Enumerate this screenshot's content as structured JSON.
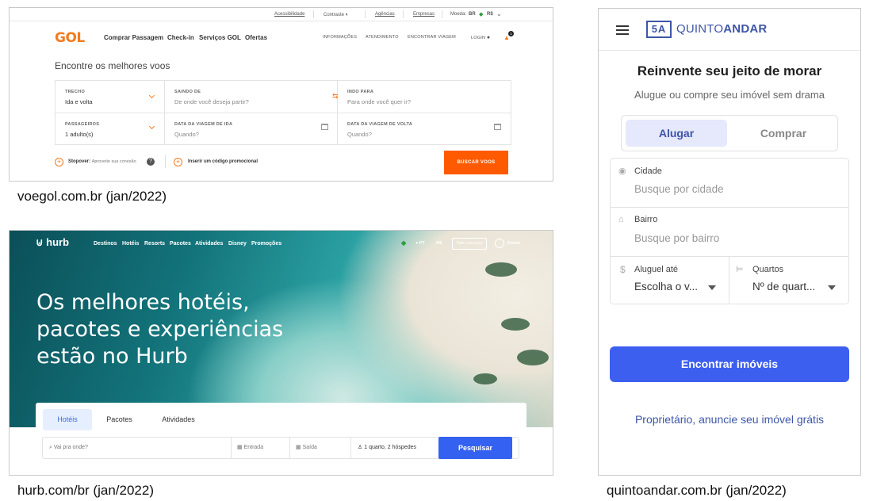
{
  "gol": {
    "topbar": {
      "acessibilidade": "Acessibilidade",
      "contraste": "Contraste",
      "agencias": "Agências",
      "empresas": "Empresas",
      "moeda": "Moeda:",
      "moeda_value": "BR",
      "currency": "R$"
    },
    "logo": "GOL",
    "nav": [
      "Comprar Passagem",
      "Check-in",
      "Serviços GOL",
      "Ofertas"
    ],
    "nav_right": [
      "INFORMAÇÕES",
      "ATENDIMENTO",
      "ENCONTRAR VIAGEM"
    ],
    "login": "LOGIN",
    "notification_count": "1",
    "heading": "Encontre os melhores voos",
    "form": {
      "trecho_label": "TRECHO",
      "trecho_value": "Ida e volta",
      "saindo_label": "SAINDO DE",
      "saindo_placeholder": "De onde você deseja partir?",
      "indo_label": "INDO PARA",
      "indo_placeholder": "Para onde você quer ir?",
      "passageiros_label": "PASSAGEIROS",
      "passageiros_value": "1 adulto(s)",
      "ida_label": "DATA DA VIAGEM DE IDA",
      "ida_placeholder": "Quando?",
      "volta_label": "DATA DA VIAGEM DE VOLTA",
      "volta_placeholder": "Quando?"
    },
    "stopover_label": "Stopover:",
    "stopover_desc": "Aproveite sua conexão",
    "promo_label": "Inserir um código promocional",
    "search_button": "BUSCAR VOOS",
    "accent_color": "#ff5a00"
  },
  "hurb": {
    "logo": "hurb",
    "nav": [
      "Destinos",
      "Hotéis",
      "Resorts",
      "Pacotes",
      "Atividades",
      "Disney",
      "Promoções"
    ],
    "lang": "PT",
    "currency": "R$",
    "contact": "Fale conosco",
    "login": "Entrar",
    "hero": [
      "Os melhores hotéis,",
      "pacotes e experiências",
      "estão no Hurb"
    ],
    "tabs": [
      "Hotéis",
      "Pacotes",
      "Atividades"
    ],
    "search": {
      "destination_placeholder": "Vai pra onde?",
      "checkin_placeholder": "Entrada",
      "checkout_placeholder": "Saída",
      "guests": "1 quarto, 2 hóspedes",
      "button": "Pesquisar"
    },
    "accent_color": "#3461f0"
  },
  "quintoandar": {
    "logo_mark": "5A",
    "logo_text_light": "QUINTO",
    "logo_text_bold": "ANDAR",
    "title": "Reinvente seu jeito de morar",
    "subtitle": "Alugue ou compre seu imóvel sem drama",
    "toggle": [
      "Alugar",
      "Comprar"
    ],
    "cidade_label": "Cidade",
    "cidade_placeholder": "Busque por cidade",
    "bairro_label": "Bairro",
    "bairro_placeholder": "Busque por bairro",
    "aluguel_label": "Aluguel até",
    "aluguel_value": "Escolha o v...",
    "quartos_label": "Quartos",
    "quartos_value": "Nº de quart...",
    "button": "Encontrar imóveis",
    "owner_link": "Proprietário, anuncie seu imóvel grátis",
    "accent_color": "#3d5ff0"
  },
  "captions": {
    "gol": "voegol.com.br (jan/2022)",
    "hurb": "hurb.com/br (jan/2022)",
    "quintoandar": "quintoandar.com.br (jan/2022)"
  }
}
